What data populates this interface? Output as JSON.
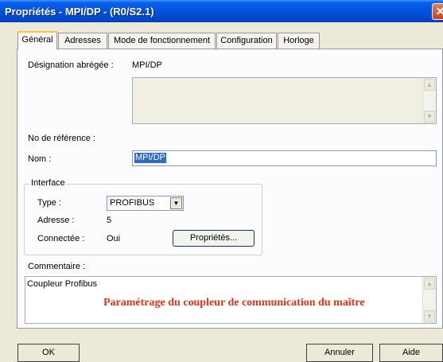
{
  "window": {
    "title": "Propriétés - MPI/DP - (R0/S2.1)",
    "close_glyph": "✕"
  },
  "tabs": [
    {
      "label": "Général",
      "active": true
    },
    {
      "label": "Adresses",
      "active": false
    },
    {
      "label": "Mode de fonctionnement",
      "active": false
    },
    {
      "label": "Configuration",
      "active": false
    },
    {
      "label": "Horloge",
      "active": false
    }
  ],
  "general": {
    "short_designation_label": "Désignation abrégée :",
    "short_designation_value": "MPI/DP",
    "reference_label": "No de référence :",
    "name_label": "Nom :",
    "name_value": "MPI/DP"
  },
  "interface": {
    "group_title": "Interface",
    "type_label": "Type :",
    "type_value": "PROFIBUS",
    "address_label": "Adresse :",
    "address_value": "5",
    "connected_label": "Connectée :",
    "connected_value": "Oui",
    "properties_button": "Propriétés..."
  },
  "comment": {
    "label": "Commentaire :",
    "value": "Coupleur Profibus",
    "overlay_note": "Paramétrage du coupleur de communication du maître"
  },
  "footer": {
    "ok_button": "OK",
    "cancel_button": "Annuler",
    "help_button": "Aide"
  },
  "icons": {
    "scroll_up": "▲",
    "scroll_down": "▼",
    "dropdown": "▼"
  },
  "colors": {
    "titlebar": "#0253de",
    "selection": "#316ac5",
    "note_red": "#e0341c",
    "active_tab_accent": "#ffc83c"
  }
}
